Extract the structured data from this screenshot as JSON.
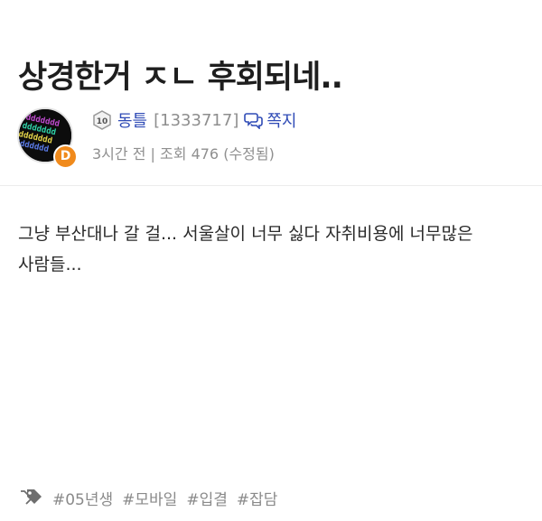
{
  "post": {
    "title": "상경한거 ㅈㄴ 후회되네..",
    "body": "그냥 부산대나 갈 걸... 서울살이 너무 싫다 자취비용에 너무많은 사람들..."
  },
  "author": {
    "level": "10",
    "grade_letter": "D",
    "nickname": "동틀",
    "user_id": "[1333717]",
    "message_label": "쪽지",
    "avatar_text": "ddddddd",
    "avatar_colors": [
      "#c04bd0",
      "#2fd3a8",
      "#e6d64a",
      "#5b7be8"
    ]
  },
  "meta": {
    "time": "3시간 전",
    "separator": "|",
    "views_label": "조회",
    "views": "476",
    "edited": "(수정됨)"
  },
  "tags": [
    "#05년생",
    "#모바일",
    "#입결",
    "#잡담"
  ],
  "colors": {
    "link": "#2f4bb6",
    "grade_badge": "#f08a1c",
    "muted": "#8e8e8e"
  },
  "icons": {
    "level": "level-badge-icon",
    "message": "speech-bubbles-icon",
    "tags": "tags-icon"
  }
}
